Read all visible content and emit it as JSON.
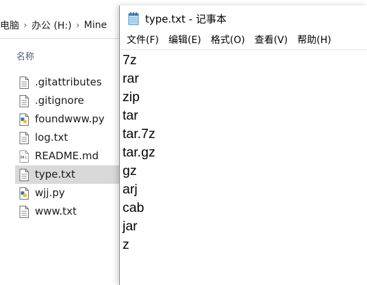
{
  "explorer": {
    "breadcrumb": [
      "电脑",
      "办公 (H:)",
      "Mine"
    ],
    "column_header": "名称",
    "files": [
      {
        "name": ".gitattributes",
        "icon": "text-file-icon",
        "selected": false
      },
      {
        "name": ".gitignore",
        "icon": "text-file-icon",
        "selected": false
      },
      {
        "name": "foundwww.py",
        "icon": "python-file-icon",
        "selected": false
      },
      {
        "name": "log.txt",
        "icon": "text-file-icon",
        "selected": false
      },
      {
        "name": "README.md",
        "icon": "markdown-file-icon",
        "selected": false
      },
      {
        "name": "type.txt",
        "icon": "text-file-icon",
        "selected": true
      },
      {
        "name": "wjj.py",
        "icon": "python-file-icon",
        "selected": false
      },
      {
        "name": "www.txt",
        "icon": "text-file-icon",
        "selected": false
      }
    ]
  },
  "notepad": {
    "title": "type.txt - 记事本",
    "menu": [
      "文件(F)",
      "编辑(E)",
      "格式(O)",
      "查看(V)",
      "帮助(H)"
    ],
    "lines": [
      "7z",
      "rar",
      "zip",
      "tar",
      "tar.7z",
      "tar.gz",
      "gz",
      "arj",
      "cab",
      "jar",
      "z"
    ]
  },
  "colors": {
    "selection": "#d9d9d9",
    "header_text": "#4c607a",
    "window_border": "#8a8a8a"
  }
}
